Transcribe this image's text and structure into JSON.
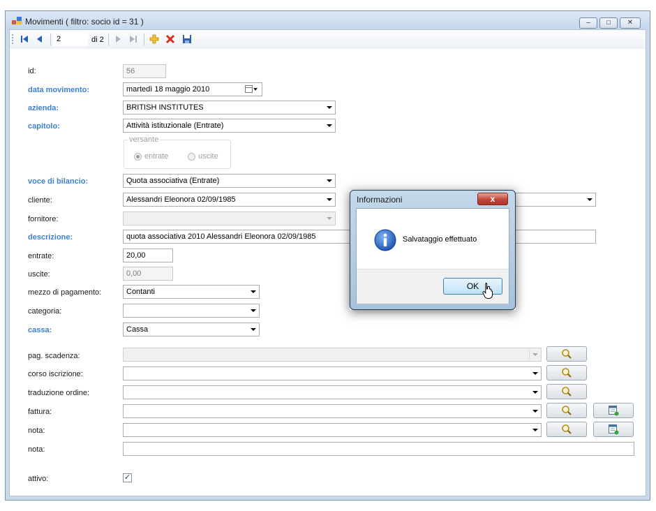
{
  "window": {
    "title": "Movimenti ( filtro: socio id = 31 )",
    "caption_min": "–",
    "caption_max": "□",
    "caption_close": "✕"
  },
  "navigator": {
    "position": "2",
    "count_label": "di 2"
  },
  "form": {
    "id_label": "id:",
    "id_value": "56",
    "data_label": "data movimento:",
    "data_value": "martedì   18   maggio   2010",
    "azienda_label": "azienda:",
    "azienda_value": "BRITISH INSTITUTES",
    "capitolo_label": "capitolo:",
    "capitolo_value": "Attività istituzionale (Entrate)",
    "versante_label": "versante",
    "radio_entrate": "entrate",
    "radio_uscite": "uscite",
    "voce_label": "voce di bilancio:",
    "voce_value": "Quota associativa (Entrate)",
    "cliente_label": "cliente:",
    "cliente_value": "Alessandri Eleonora 02/09/1985",
    "fornitore_label": "fornitore:",
    "descrizione_label": "descrizione:",
    "descrizione_value": "quota associativa 2010 Alessandri Eleonora 02/09/1985",
    "entrate_label": "entrate:",
    "entrate_value": "20,00",
    "uscite_label": "uscite:",
    "uscite_value": "0,00",
    "mezzo_label": "mezzo di pagamento:",
    "mezzo_value": "Contanti",
    "categoria_label": "categoria:",
    "cassa_label": "cassa:",
    "cassa_value": "Cassa",
    "pag_scadenza_label": "pag. scadenza:",
    "corso_label": "corso iscrizione:",
    "traduzione_label": "traduzione ordine:",
    "fattura_label": "fattura:",
    "nota_combo_label": "nota:",
    "nota_label": "nota:",
    "attivo_label": "attivo:",
    "attivo_check": "✓"
  },
  "dialog": {
    "title": "Informazioni",
    "message": "Salvataggio effettuato",
    "ok": "OK",
    "close": "x"
  },
  "colors": {
    "bold_label": "#3c7fd8",
    "window_frame": "#c9d9ea"
  }
}
